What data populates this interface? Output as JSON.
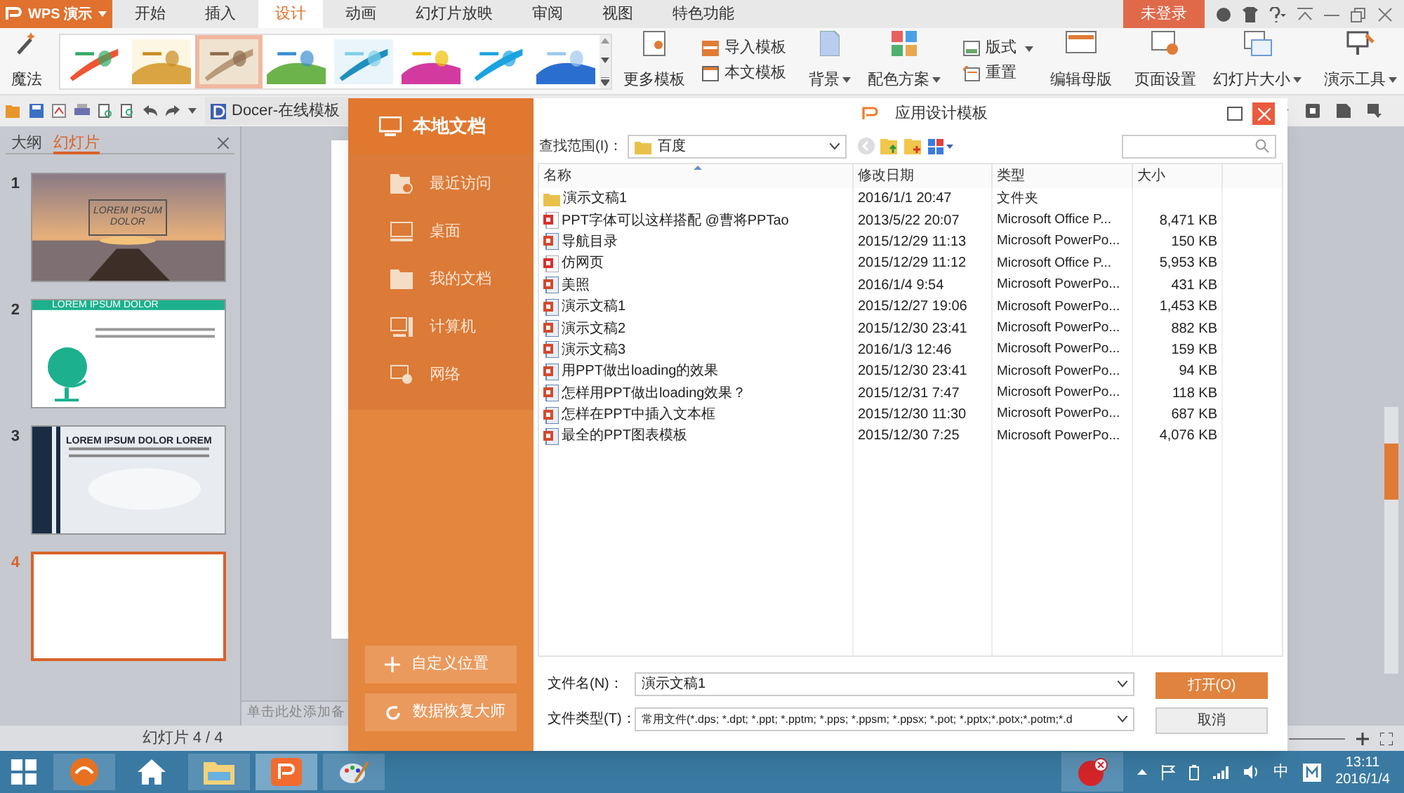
{
  "app": {
    "logo": "WPS 演示",
    "login": "未登录"
  },
  "menu_tabs": [
    {
      "label": "开始",
      "selected": false
    },
    {
      "label": "插入",
      "selected": false
    },
    {
      "label": "设计",
      "selected": true
    },
    {
      "label": "动画",
      "selected": false
    },
    {
      "label": "幻灯片放映",
      "selected": false
    },
    {
      "label": "审阅",
      "selected": false
    },
    {
      "label": "视图",
      "selected": false
    },
    {
      "label": "特色功能",
      "selected": false
    }
  ],
  "ribbon": {
    "magic": "魔法",
    "templates": [
      {
        "selected": false
      },
      {
        "selected": false
      },
      {
        "selected": true
      },
      {
        "selected": false
      },
      {
        "selected": false
      },
      {
        "selected": false
      },
      {
        "selected": false
      },
      {
        "selected": false
      }
    ],
    "more_templates": "更多模板",
    "import_template": "导入模板",
    "this_template": "本文模板",
    "background": "背景",
    "color_scheme": "配色方案",
    "layout": "版式",
    "reset": "重置",
    "edit_master": "编辑母版",
    "page_setup": "页面设置",
    "slide_size": "幻灯片大小",
    "presenter_tools": "演示工具"
  },
  "quick_bar": {
    "docer_tab": "Docer-在线模板"
  },
  "side_panel": {
    "tabs": [
      {
        "label": "大纲",
        "selected": false
      },
      {
        "label": "幻灯片",
        "selected": true
      }
    ],
    "slides": [
      {
        "number": "1",
        "selected": false,
        "title": "LOREM IPSUM DOLOR"
      },
      {
        "number": "2",
        "selected": false,
        "title": "LOREM IPSUM DOLOR"
      },
      {
        "number": "3",
        "selected": false,
        "title": "LOREM IPSUM DOLOR LOREM"
      },
      {
        "number": "4",
        "selected": true
      }
    ]
  },
  "notes_placeholder": "单击此处添加备",
  "status_bar": {
    "slide_count": "幻灯片 4 / 4"
  },
  "dialog": {
    "title": "应用设计模板",
    "sidebar_header": "本地文档",
    "places": [
      "最近访问",
      "桌面",
      "我的文档",
      "计算机",
      "网络"
    ],
    "custom_location": "自定义位置",
    "data_recovery": "数据恢复大师",
    "look_in_label": "查找范围(I)：",
    "look_in_value": "百度",
    "columns": [
      "名称",
      "修改日期",
      "类型",
      "大小"
    ],
    "rows": [
      {
        "kind": "folder",
        "name": "演示文稿1",
        "date": "2016/1/1 20:47",
        "type": "文件夹"
      },
      {
        "kind": "office",
        "name": "PPT字体可以这样搭配 @曹将PPTao",
        "date": "2013/5/22 20:07",
        "type": "Microsoft Office P...",
        "size": "8,471 KB"
      },
      {
        "kind": "ppt",
        "name": "导航目录",
        "date": "2015/12/29 11:13",
        "type": "Microsoft PowerPo...",
        "size": "150 KB"
      },
      {
        "kind": "office",
        "name": "仿网页",
        "date": "2015/12/29 11:12",
        "type": "Microsoft Office P...",
        "size": "5,953 KB"
      },
      {
        "kind": "ppt",
        "name": "美照",
        "date": "2016/1/4 9:54",
        "type": "Microsoft PowerPo...",
        "size": "431 KB"
      },
      {
        "kind": "ppt",
        "name": "演示文稿1",
        "date": "2015/12/27 19:06",
        "type": "Microsoft PowerPo...",
        "size": "1,453 KB"
      },
      {
        "kind": "ppt",
        "name": "演示文稿2",
        "date": "2015/12/30 23:41",
        "type": "Microsoft PowerPo...",
        "size": "882 KB"
      },
      {
        "kind": "ppt",
        "name": "演示文稿3",
        "date": "2016/1/3 12:46",
        "type": "Microsoft PowerPo...",
        "size": "159 KB"
      },
      {
        "kind": "ppt",
        "name": "用PPT做出loading的效果",
        "date": "2015/12/30 23:41",
        "type": "Microsoft PowerPo...",
        "size": "94 KB"
      },
      {
        "kind": "ppt",
        "name": "怎样用PPT做出loading效果？",
        "date": "2015/12/31 7:47",
        "type": "Microsoft PowerPo...",
        "size": "118 KB"
      },
      {
        "kind": "ppt",
        "name": "怎样在PPT中插入文本框",
        "date": "2015/12/30 11:30",
        "type": "Microsoft PowerPo...",
        "size": "687 KB"
      },
      {
        "kind": "ppt",
        "name": "最全的PPT图表模板",
        "date": "2015/12/30 7:25",
        "type": "Microsoft PowerPo...",
        "size": "4,076 KB"
      }
    ],
    "file_name_label": "文件名(N)：",
    "file_name_value": "演示文稿1",
    "file_type_label": "文件类型(T)：",
    "file_type_value": "常用文件(*.dps; *.dpt; *.ppt; *.pptm; *.pps; *.ppsm; *.ppsx; *.pot; *.pptx;*.potx;*.potm;*.d",
    "open_button": "打开(O)",
    "cancel_button": "取消"
  },
  "taskbar": {
    "ime": "中",
    "time": "13:11",
    "date": "2016/1/4"
  }
}
